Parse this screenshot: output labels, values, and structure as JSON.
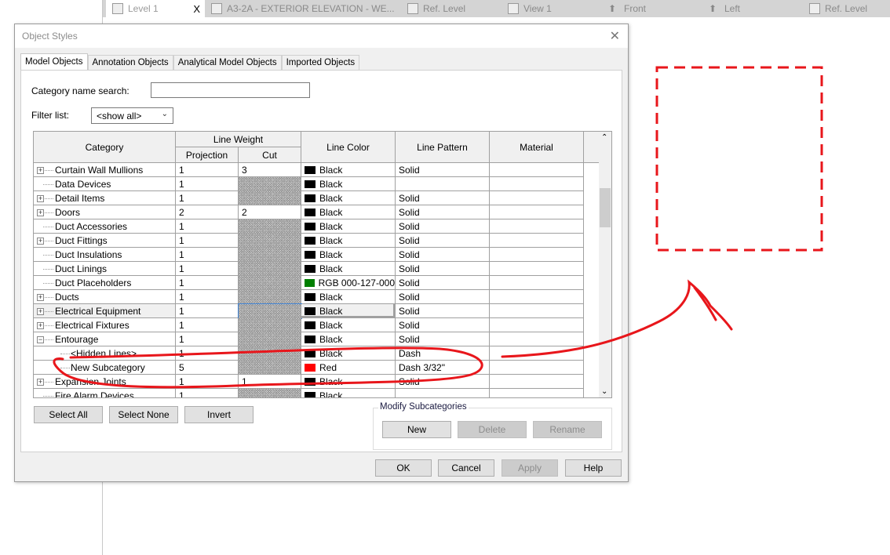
{
  "view_tabs": [
    {
      "label": "Level 1",
      "icon": "floor-plan-icon",
      "active": true,
      "close": "X"
    },
    {
      "label": "A3-2A - EXTERIOR ELEVATION - WE...",
      "icon": "sheet-icon"
    },
    {
      "label": "Ref. Level",
      "icon": "floor-plan-icon"
    },
    {
      "label": "View 1",
      "icon": "3d-view-icon"
    },
    {
      "label": "Front",
      "icon": "elevation-arrow-icon"
    },
    {
      "label": "Left",
      "icon": "elevation-arrow-icon"
    },
    {
      "label": "Ref. Level",
      "icon": "floor-plan-icon"
    }
  ],
  "dialog": {
    "title": "Object Styles",
    "tabs": [
      "Model Objects",
      "Annotation Objects",
      "Analytical Model Objects",
      "Imported Objects"
    ],
    "search_label": "Category name search:",
    "search_value": "",
    "filter_label": "Filter list:",
    "filter_value": "<show all>",
    "columns": {
      "category": "Category",
      "line_weight": "Line Weight",
      "projection": "Projection",
      "cut": "Cut",
      "line_color": "Line Color",
      "line_pattern": "Line Pattern",
      "material": "Material"
    },
    "rows": [
      {
        "category": "Curtain Wall Mullions",
        "expander": "plus",
        "level": 0,
        "projection": "1",
        "cut": "3",
        "color": "Black",
        "swatch": "#000000",
        "pattern": "Solid"
      },
      {
        "category": "Data Devices",
        "expander": "",
        "level": 0,
        "projection": "1",
        "cut": null,
        "color": "Black",
        "swatch": "#000000",
        "pattern": ""
      },
      {
        "category": "Detail Items",
        "expander": "plus",
        "level": 0,
        "projection": "1",
        "cut": null,
        "color": "Black",
        "swatch": "#000000",
        "pattern": "Solid"
      },
      {
        "category": "Doors",
        "expander": "plus",
        "level": 0,
        "projection": "2",
        "cut": "2",
        "color": "Black",
        "swatch": "#000000",
        "pattern": "Solid"
      },
      {
        "category": "Duct Accessories",
        "expander": "",
        "level": 0,
        "projection": "1",
        "cut": null,
        "color": "Black",
        "swatch": "#000000",
        "pattern": "Solid"
      },
      {
        "category": "Duct Fittings",
        "expander": "plus",
        "level": 0,
        "projection": "1",
        "cut": null,
        "color": "Black",
        "swatch": "#000000",
        "pattern": "Solid"
      },
      {
        "category": "Duct Insulations",
        "expander": "",
        "level": 0,
        "projection": "1",
        "cut": null,
        "color": "Black",
        "swatch": "#000000",
        "pattern": "Solid"
      },
      {
        "category": "Duct Linings",
        "expander": "",
        "level": 0,
        "projection": "1",
        "cut": null,
        "color": "Black",
        "swatch": "#000000",
        "pattern": "Solid"
      },
      {
        "category": "Duct Placeholders",
        "expander": "",
        "level": 0,
        "projection": "1",
        "cut": null,
        "color": "RGB 000-127-000",
        "swatch": "#007f00",
        "pattern": "Solid"
      },
      {
        "category": "Ducts",
        "expander": "plus",
        "level": 0,
        "projection": "1",
        "cut": null,
        "color": "Black",
        "swatch": "#000000",
        "pattern": "Solid"
      },
      {
        "category": "Electrical Equipment",
        "expander": "plus",
        "level": 0,
        "projection": "1",
        "cut": null,
        "color": "Black",
        "swatch": "#000000",
        "pattern": "Solid",
        "selected": true
      },
      {
        "category": "Electrical Fixtures",
        "expander": "plus",
        "level": 0,
        "projection": "1",
        "cut": null,
        "color": "Black",
        "swatch": "#000000",
        "pattern": "Solid"
      },
      {
        "category": "Entourage",
        "expander": "minus",
        "level": 0,
        "projection": "1",
        "cut": null,
        "color": "Black",
        "swatch": "#000000",
        "pattern": "Solid"
      },
      {
        "category": "<Hidden Lines>",
        "expander": "",
        "level": 1,
        "projection": "1",
        "cut": null,
        "color": "Black",
        "swatch": "#000000",
        "pattern": "Dash"
      },
      {
        "category": "New Subcategory",
        "expander": "",
        "level": 1,
        "projection": "5",
        "cut": null,
        "color": "Red",
        "swatch": "#ff0000",
        "pattern": "Dash 3/32\""
      },
      {
        "category": "Expansion Joints",
        "expander": "plus",
        "level": 0,
        "projection": "1",
        "cut": "1",
        "color": "Black",
        "swatch": "#000000",
        "pattern": "Solid"
      },
      {
        "category": "Fire Alarm Devices",
        "expander": "",
        "level": 0,
        "projection": "1",
        "cut": null,
        "color": "Black",
        "swatch": "#000000",
        "pattern": ""
      }
    ],
    "buttons": {
      "select_all": "Select All",
      "select_none": "Select None",
      "invert": "Invert"
    },
    "modify": {
      "legend": "Modify Subcategories",
      "new": "New",
      "delete": "Delete",
      "rename": "Rename"
    },
    "footer": {
      "ok": "OK",
      "cancel": "Cancel",
      "apply": "Apply",
      "help": "Help"
    }
  },
  "annotation_color": "#e8161b"
}
